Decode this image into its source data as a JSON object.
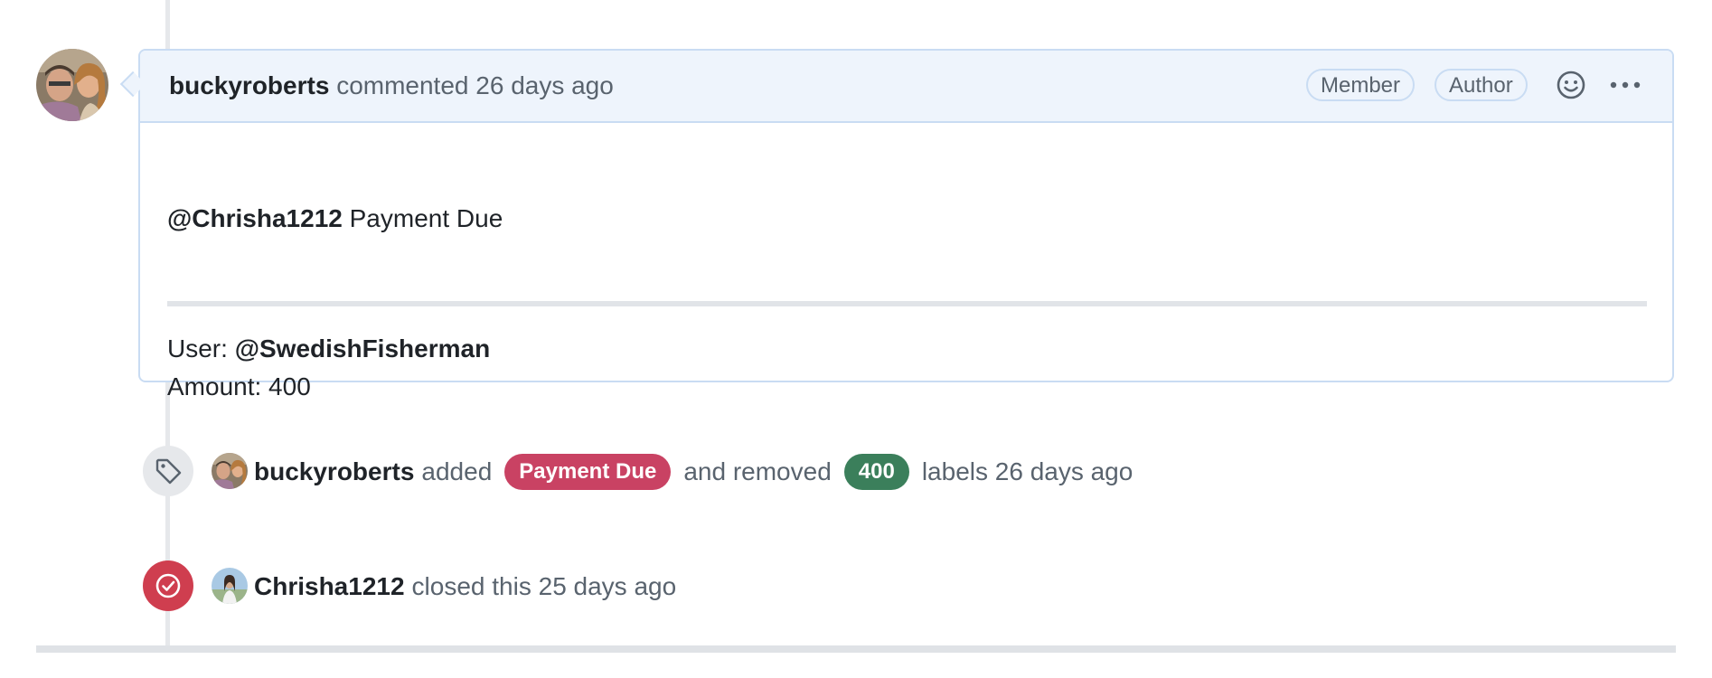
{
  "comment": {
    "author": "buckyroberts",
    "action": "commented",
    "time": "26 days ago",
    "badges": [
      "Member",
      "Author"
    ],
    "icons": [
      "smiley-icon",
      "kebab-horizontal-icon"
    ],
    "body": {
      "mention": "@Chrisha1212",
      "title_text": "Payment Due",
      "user_label": "User:",
      "user_mention": "@SwedishFisherman",
      "amount_line": "Amount: 400"
    }
  },
  "events": [
    {
      "icon": "tag-icon",
      "actor": "buckyroberts",
      "added_word": "added",
      "added_label": "Payment Due",
      "added_label_color": "#c94263",
      "removed_word": "and removed",
      "removed_label": "400",
      "removed_label_color": "#3b7f5b",
      "suffix": "labels 26 days ago"
    },
    {
      "icon": "issue-closed-icon",
      "actor": "Chrisha1212",
      "text": "closed this 25 days ago",
      "status_color": "#cf3e4f"
    }
  ]
}
